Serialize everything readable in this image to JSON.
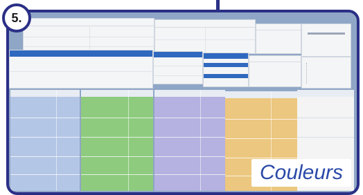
{
  "badge": {
    "text": "5."
  },
  "caption": {
    "text": "Couleurs"
  },
  "colors": {
    "frame": "#2a2f86",
    "wall": "#8fa6c6",
    "col_blue": "#b4c6e6",
    "col_green": "#8ecb7f",
    "col_purple": "#b5b1e0",
    "col_yellow": "#ecc77f",
    "col_white": "#f4f4f4",
    "header_blue": "#2f68bf",
    "caption_text": "#2a49a8"
  }
}
